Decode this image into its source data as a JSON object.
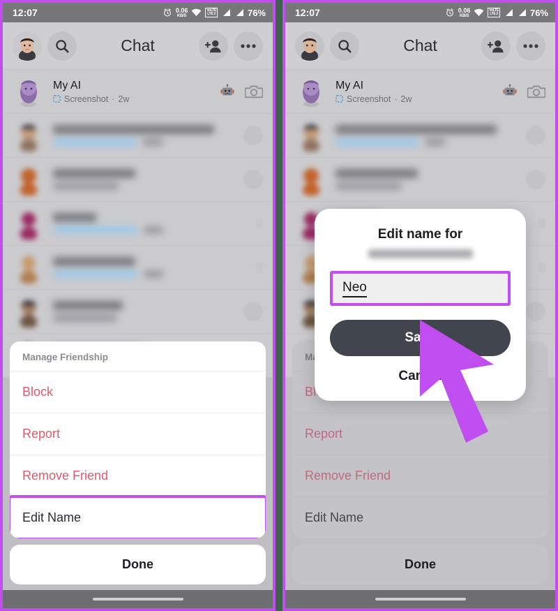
{
  "status_bar": {
    "time": "12:07",
    "alarm_icon": "alarm-clock-icon",
    "net_speed_value": "0.06",
    "net_speed_unit": "KB/S",
    "wifi_icon": "wifi-icon",
    "volte_line1": "VoLTE",
    "volte_line2": "LTE 2",
    "signal_icon_1": "signal-bars-icon",
    "signal_icon_2": "signal-bars-icon",
    "battery": "76%"
  },
  "header": {
    "avatar_icon": "profile-avatar",
    "search_icon": "search-icon",
    "title": "Chat",
    "add_friend_icon": "add-friend-icon",
    "more_icon": "more-options-icon"
  },
  "chat_list": [
    {
      "name": "My AI",
      "status_icon": "screenshot-icon",
      "status": "Screenshot",
      "separator": "·",
      "time": "2w",
      "right_icon_1": "robot-icon",
      "right_icon_2": "camera-icon",
      "blurred": false
    },
    {
      "name": "",
      "status": "",
      "time": "",
      "blurred": true,
      "avatar_color": "#8f7560",
      "has_blue_pill": true
    },
    {
      "name": "",
      "status": "",
      "time": "",
      "blurred": true,
      "avatar_color": "#c2622a",
      "has_blue_pill": false
    },
    {
      "name": "",
      "status": "",
      "time": "",
      "blurred": true,
      "avatar_color": "#9a2a63",
      "has_blue_pill": true
    },
    {
      "name": "",
      "status": "",
      "time": "",
      "blurred": true,
      "avatar_color": "#b08050",
      "has_blue_pill": true
    },
    {
      "name": "",
      "status": "",
      "time": "",
      "blurred": true,
      "avatar_color": "#6d5543",
      "has_blue_pill": false
    },
    {
      "name": "",
      "status": "",
      "time": "",
      "blurred": true,
      "avatar_color": "#7a5c48",
      "has_blue_pill": false
    }
  ],
  "action_sheet": {
    "title": "Manage Friendship",
    "items": [
      {
        "label": "Block",
        "style": "destructive"
      },
      {
        "label": "Report",
        "style": "destructive"
      },
      {
        "label": "Remove Friend",
        "style": "destructive"
      },
      {
        "label": "Edit Name",
        "style": "neutral",
        "highlighted": true
      }
    ],
    "done_label": "Done"
  },
  "dialog": {
    "title": "Edit name for",
    "subtitle_blurred": true,
    "input_value": "Neo",
    "save_label": "Save",
    "cancel_label": "Cancel"
  },
  "cursor": {
    "icon": "mouse-pointer-icon",
    "color": "#c04ef0"
  },
  "colors": {
    "highlight_border": "#c04ef0",
    "destructive_text": "#e05a6e",
    "save_button": "#40454e",
    "status_bar_bg": "#77777a",
    "header_bg": "#cfcfd2",
    "page_gap": "#3f6049"
  }
}
